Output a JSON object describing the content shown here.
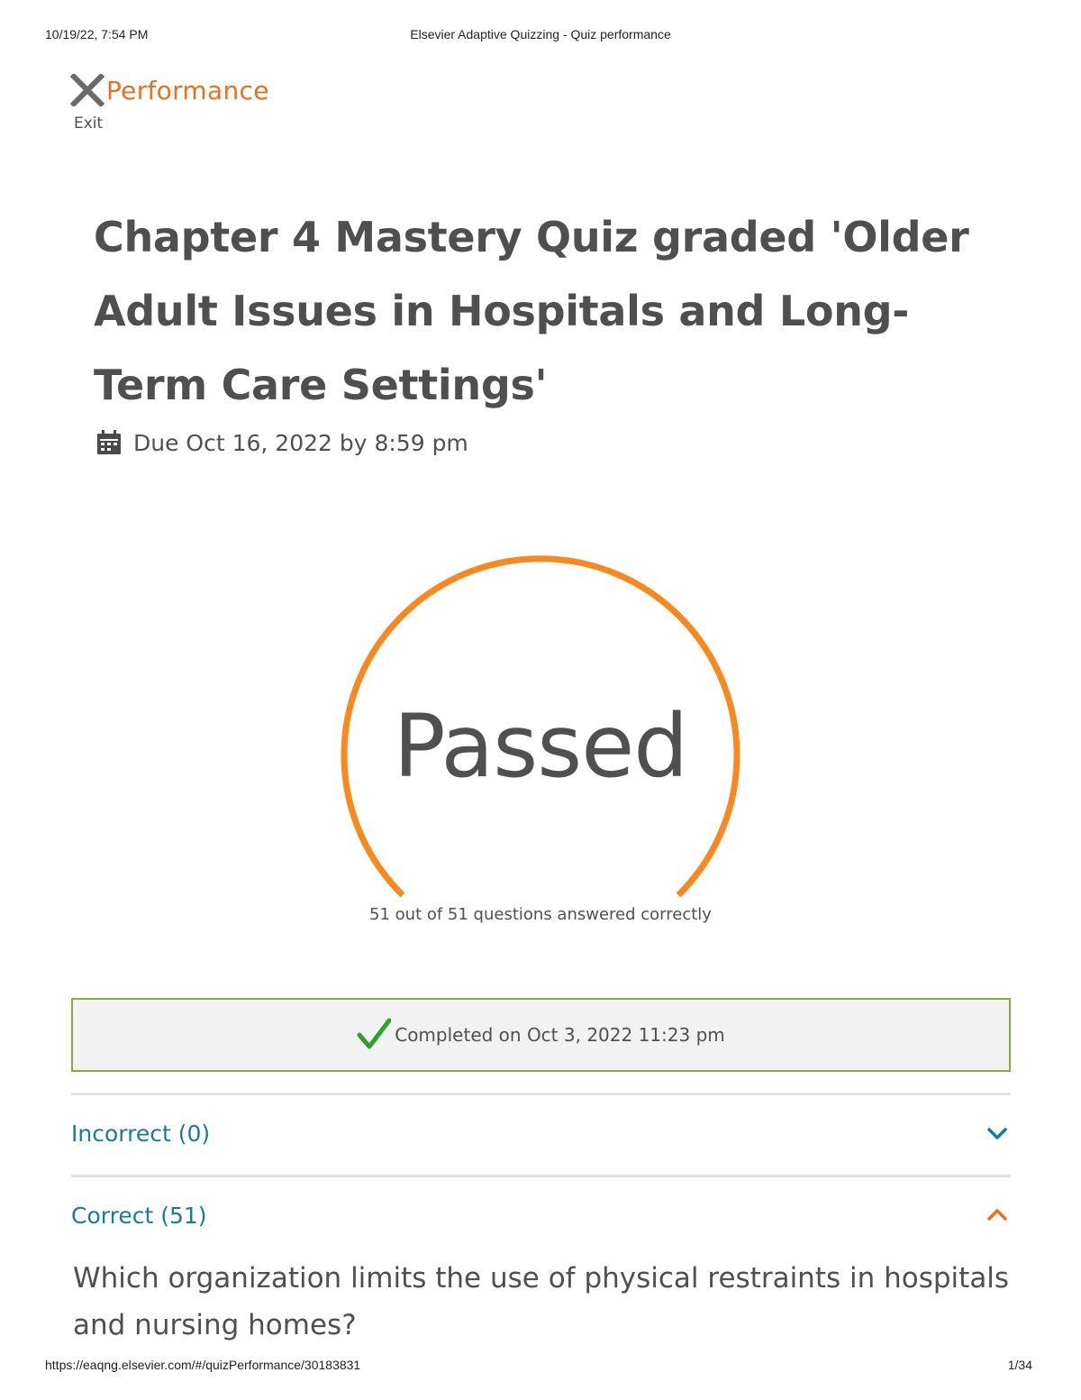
{
  "print_header": {
    "datetime": "10/19/22, 7:54 PM",
    "document_title": "Elsevier Adaptive Quizzing - Quiz performance"
  },
  "print_footer": {
    "url": "https://eaqng.elsevier.com/#/quizPerformance/30183831",
    "page": "1/34"
  },
  "header": {
    "exit_icon": "close-icon",
    "exit_label": "Exit",
    "page_heading": "Performance"
  },
  "quiz": {
    "title": "Chapter 4 Mastery Quiz graded 'Older Adult Issues in Hospitals and Long-Term Care Settings'",
    "due_icon": "calendar-icon",
    "due": "Due Oct 16, 2022 by 8:59 pm"
  },
  "result": {
    "status": "Passed",
    "correct": 51,
    "total": 51,
    "summary": "51 out of 51 questions answered correctly",
    "completed_icon": "checkmark-icon",
    "completed": "Completed on Oct 3, 2022 11:23 pm"
  },
  "sections": [
    {
      "label": "Incorrect (0)",
      "expanded": false,
      "icon": "chevron-down-icon"
    },
    {
      "label": "Correct (51)",
      "expanded": true,
      "icon": "chevron-up-icon"
    }
  ],
  "first_question": "Which organization limits the use of physical restraints in hospitals and nursing homes?",
  "colors": {
    "accent": "#e9711c",
    "gauge": "#f7891f",
    "link": "#1a7a9c",
    "success_border": "#7fae3a",
    "check": "#2da02d",
    "text": "#4f4f4f"
  }
}
